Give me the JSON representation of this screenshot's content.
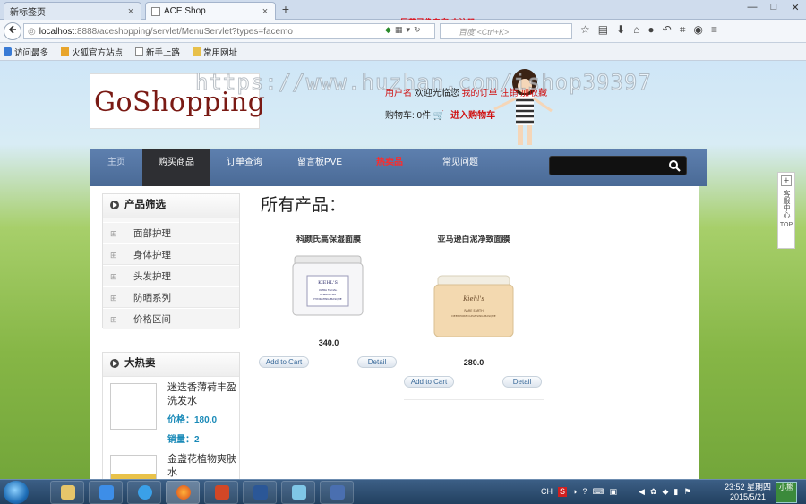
{
  "browser": {
    "tabs": [
      {
        "title": "新标签页",
        "close": "×"
      },
      {
        "title": "ACE Shop",
        "close": "×"
      }
    ],
    "new_tab": "+",
    "window_buttons": [
      "—",
      "□",
      "✕"
    ],
    "url_host": "localhost",
    "url_path": ":8888/aceshopping/servlet/MenuServlet?types=facemo",
    "search_placeholder": "百度 <Ctrl+K>",
    "recording_note": "屏幕录像专家  未注册",
    "bookmarks": [
      "访问最多",
      "火狐官方站点",
      "新手上路",
      "常用网址"
    ]
  },
  "header": {
    "logo": "GoShopping",
    "watermark": "https://www.huzhan.com/ishop39397",
    "links_prefix": "用户名",
    "links_mid": "  欢迎光临您  ",
    "links_suffix": "我的订单  注销   加收藏",
    "cart_label": "购物车: 0件",
    "cart_link": "进入购物车"
  },
  "nav": {
    "items": [
      "主页",
      "购买商品",
      "订单查询",
      "留言板PVE",
      "热卖品",
      "常见问题"
    ],
    "active_index": 1,
    "hot_index": 4
  },
  "sidebar": {
    "filter_title": "产品筛选",
    "filters": [
      "面部护理",
      "身体护理",
      "头发护理",
      "防晒系列",
      "价格区间"
    ],
    "hot_title": "大热卖",
    "hot_items": [
      {
        "name": "迷迭香薄荷丰盈洗发水",
        "price": "价格：180.0",
        "sales": "销量：2"
      },
      {
        "name": "金盏花植物爽肤水",
        "price": "",
        "sales": ""
      }
    ]
  },
  "main": {
    "heading": "所有产品：",
    "products": [
      {
        "name": "科颜氏高保湿面膜",
        "price": "340.0",
        "add": "Add to Cart",
        "detail": "Detail",
        "jar_label": "KIEHL'S ULTRA FACIAL OVERNIGHT HYDRATING MASQUE"
      },
      {
        "name": "亚马逊白泥净致面膜",
        "price": "280.0",
        "add": "Add to Cart",
        "detail": "Detail",
        "jar_label": "Kiehl's RARE EARTH DEEP PORE CLEANSING MASQUE"
      }
    ]
  },
  "right_widget": {
    "label": "客服中心",
    "top": "TOP"
  },
  "taskbar": {
    "apps": [
      "explorer",
      "baidu",
      "ie",
      "firefox",
      "ppt",
      "word",
      "tool",
      "app8"
    ],
    "tray_text": "CH",
    "time": "23:52 星期四",
    "date": "2015/5/21",
    "desktop": "小熊"
  },
  "colors": {
    "accent_red": "#d01010",
    "nav_bg": "#4a6a96",
    "price_blue": "#1a8ab8"
  }
}
